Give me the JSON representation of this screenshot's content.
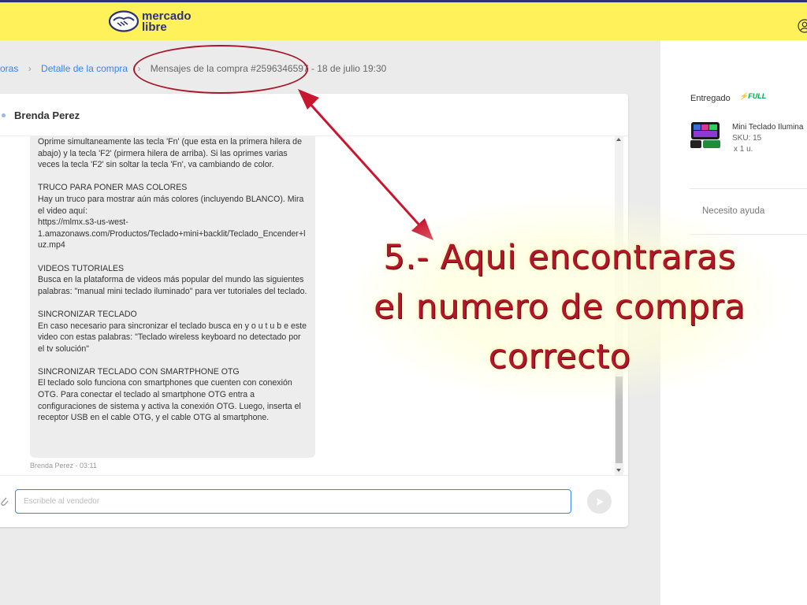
{
  "header": {
    "logo_text_line1": "mercado",
    "logo_text_line2": "libre",
    "brand_color": "#fff159",
    "icons": [
      "handshake-logo-icon",
      "user-icon"
    ]
  },
  "breadcrumb": {
    "items": [
      "oras",
      "Detalle de la compra",
      "Mensajes de la compra #2596346597 - 18 de julio 19:30"
    ]
  },
  "chat": {
    "seller_name": "Brenda Perez",
    "message_paragraphs": [
      "Oprime simultaneamente las tecla 'Fn' (que esta en la primera hilera de abajo) y la tecla 'F2' (pirmera hilera de arriba). Si las oprimes varias veces la tecla 'F2' sin soltar la tecla 'Fn', va cambiando de color.",
      "TRUCO PARA PONER MAS COLORES\nHay un truco para mostrar aún más colores (incluyendo BLANCO). Mira el video aquí:\nhttps://mlmx.s3-us-west-1.amazonaws.com/Productos/Teclado+mini+backlit/Teclado_Encender+luz.mp4",
      "VIDEOS TUTORIALES\nBusca en la plataforma de videos más popular del mundo las siguientes palabras: \"manual mini teclado iluminado\" para ver tutoriales del teclado.",
      "SINCRONIZAR TECLADO\nEn caso necesario para sincronizar el teclado busca en y o u t u b e este video con estas palabras: \"Teclado wireless keyboard no detectado por el tv solución\"",
      "SINCRONIZAR TECLADO CON SMARTPHONE OTG\nEl teclado solo funciona con smartphones que cuenten con conexión OTG. Para conectar el teclado al smartphone OTG entra a configuraciones de sistema y activa la conexión OTG. Luego, inserta el receptor USB en el cable OTG, y el cable OTG al smartphone."
    ],
    "message_meta": "Brenda Perez - 03:11",
    "input_placeholder": "Escribele al vendedor",
    "input_value": "",
    "accent_color": "#3483fa"
  },
  "sidebar": {
    "status": "Entregado",
    "badge": "FULL",
    "badge_color": "#00a650",
    "product_name": "Mini Teclado Ilumina",
    "product_sku": "SKU: 15",
    "product_qty": "x 1 u.",
    "help_link": "Necesito ayuda"
  },
  "annotation": {
    "line1": "5.- Aqui encontraras",
    "line2": "el numero de compra",
    "line3": "correcto",
    "color": "#b3152c"
  }
}
